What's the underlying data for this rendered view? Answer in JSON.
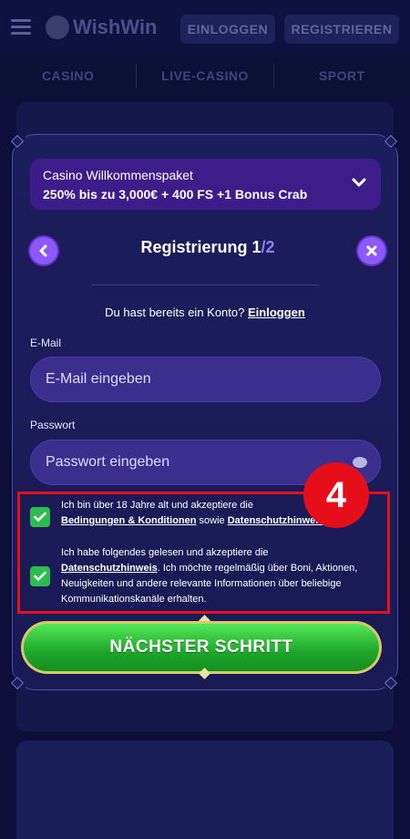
{
  "background": {
    "brand": "WishWin",
    "header_login": "EINLOGGEN",
    "header_register": "REGISTRIEREN",
    "tabs": [
      "CASINO",
      "LIVE-CASINO",
      "SPORT"
    ]
  },
  "promo": {
    "title": "Casino Willkommenspaket",
    "offer": "250% bis zu 3,000€ + 400 FS +1 Bonus Crab"
  },
  "registration": {
    "title": "Registrierung 1",
    "step_total": "/2",
    "have_account": "Du hast bereits ein Konto?",
    "login_link": "Einloggen"
  },
  "email": {
    "label": "E-Mail",
    "placeholder": "E-Mail eingeben"
  },
  "password": {
    "label": "Passwort",
    "placeholder": "Passwort eingeben"
  },
  "consents": [
    {
      "checked": true,
      "text_1": "Ich bin über 18 Jahre alt und akzeptiere die",
      "link_1": "Bedingungen & Konditionen",
      "text_2": " sowie ",
      "link_2": "Datenschutzhinweis"
    },
    {
      "checked": true,
      "text_1": "Ich habe folgendes gelesen und akzeptiere die",
      "link_1": "Datenschutzhinweis",
      "text_2": ". Ich möchte regelmäßig über Boni, Aktionen, Neuigkeiten und andere relevante Informationen über beliebige Kommunikationskanäle erhalten."
    }
  ],
  "annotation_badge": "4",
  "next_button": "NÄCHSTER SCHRITT",
  "colors": {
    "accent_purple": "#8e58ff",
    "checkbox_green": "#2bbd50",
    "highlight_red": "#e4101c",
    "button_green": "#1ea62b"
  }
}
